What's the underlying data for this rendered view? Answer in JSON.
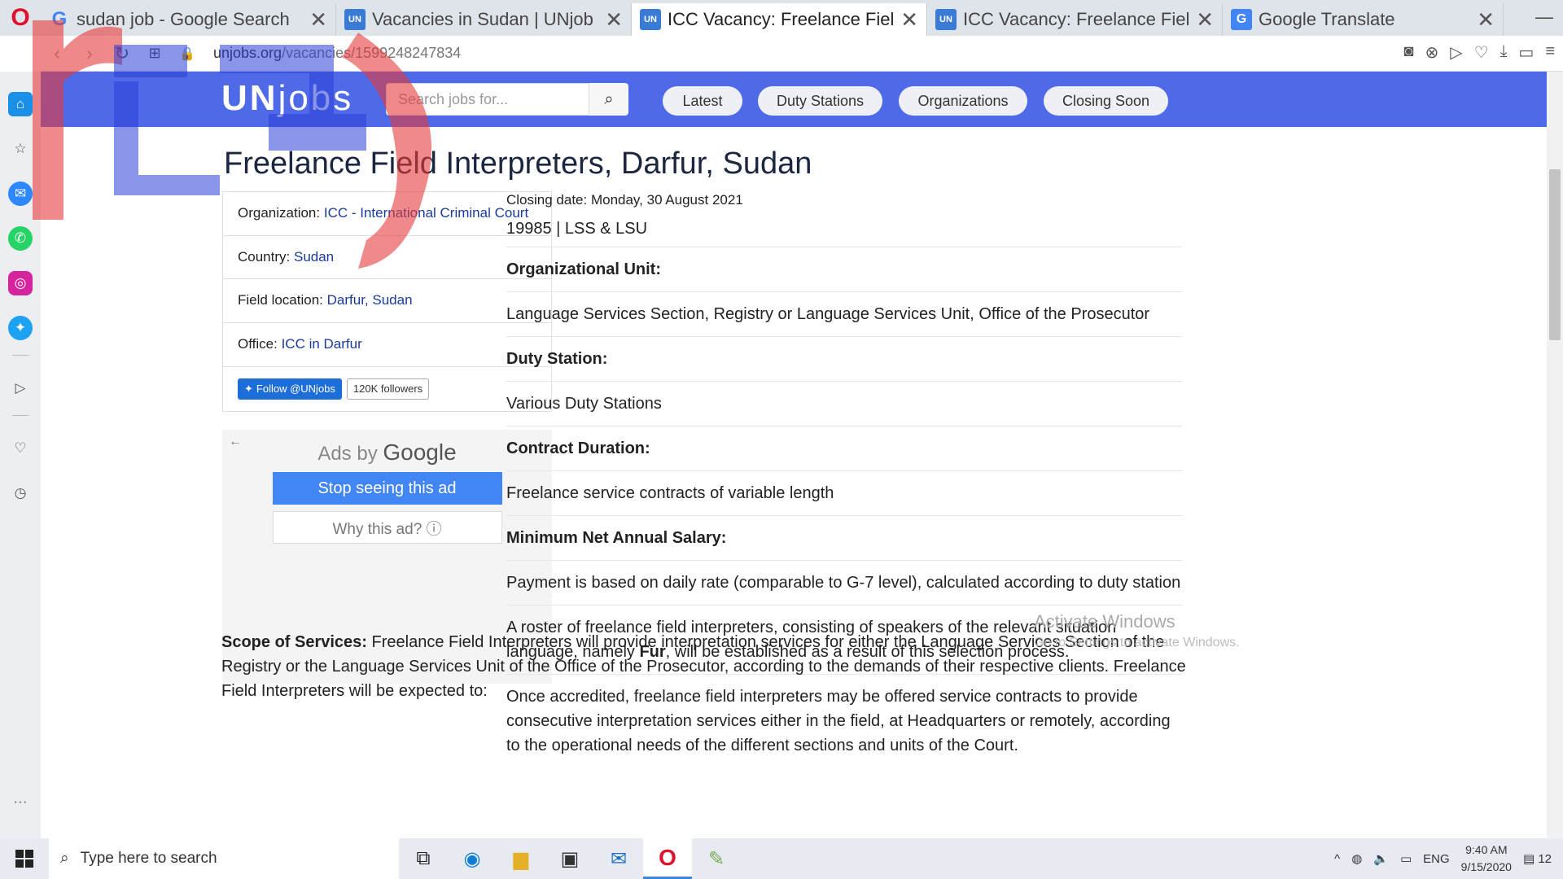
{
  "browser": {
    "tabs": [
      {
        "title": "sudan job - Google Search",
        "fav": "G",
        "kind": "g"
      },
      {
        "title": "Vacancies in Sudan | UNjob",
        "fav": "UN",
        "kind": "un"
      },
      {
        "title": "ICC Vacancy: Freelance Fiel",
        "fav": "UN",
        "kind": "un"
      },
      {
        "title": "ICC Vacancy: Freelance Fiel",
        "fav": "UN",
        "kind": "un"
      },
      {
        "title": "Google Translate",
        "fav": "G",
        "kind": "tr"
      }
    ],
    "url_host": "unjobs.org",
    "url_path": "/vacancies/1599248247834"
  },
  "site": {
    "logo_a": "UN",
    "logo_b": "jobs",
    "search_placeholder": "Search jobs for...",
    "nav": [
      "Latest",
      "Duty Stations",
      "Organizations",
      "Closing Soon"
    ]
  },
  "job": {
    "title": "Freelance Field Interpreters, Darfur, Sudan",
    "org_label": "Organization:",
    "org_value": "ICC - International Criminal Court",
    "country_label": "Country:",
    "country_value": "Sudan",
    "field_label": "Field location:",
    "field_value": "Darfur, Sudan",
    "office_label": "Office:",
    "office_value": "ICC in Darfur",
    "follow_label": "Follow @UNjobs",
    "followers": "120K followers",
    "closing": "Closing date: Monday, 30 August 2021",
    "code": "19985 | LSS & LSU",
    "unit_h": "Organizational Unit:",
    "unit_v": "Language Services Section, Registry or Language Services Unit, Office of the Prosecutor",
    "duty_h": "Duty Station:",
    "duty_v": "Various Duty Stations",
    "contract_h": "Contract Duration:",
    "contract_v": "Freelance service contracts of variable length",
    "salary_h": "Minimum Net Annual Salary:",
    "salary_v": "Payment is based on daily rate (comparable to G-7 level), calculated according to duty station",
    "roster_a": "A roster of freelance field interpreters, consisting of speakers of the relevant situation language, namely ",
    "roster_b": "Fur",
    "roster_c": ", will be established as a result of this selection process.",
    "accredited": "Once accredited, freelance field interpreters may be offered service contracts to provide consecutive interpretation services either in the field, at Headquarters or remotely, according to the operational needs of the different sections and units of the Court.",
    "scope_h": "Scope of Services:",
    "scope_v": " Freelance Field Interpreters will provide interpretation services for either the Language Services Section of the Registry or the Language Services Unit of the Office of the Prosecutor, according to the demands of their respective clients. Freelance Field Interpreters will be expected to:"
  },
  "ad": {
    "ads_by": "Ads by",
    "google": "Google",
    "stop": "Stop seeing this ad",
    "why": "Why this ad? ⓘ"
  },
  "watermark": {
    "line1": "Activate Windows",
    "line2": "Go to Settings to activate Windows."
  },
  "taskbar": {
    "search": "Type here to search",
    "lang": "ENG",
    "time": "9:40 AM",
    "date": "9/15/2020",
    "notif": "12"
  }
}
